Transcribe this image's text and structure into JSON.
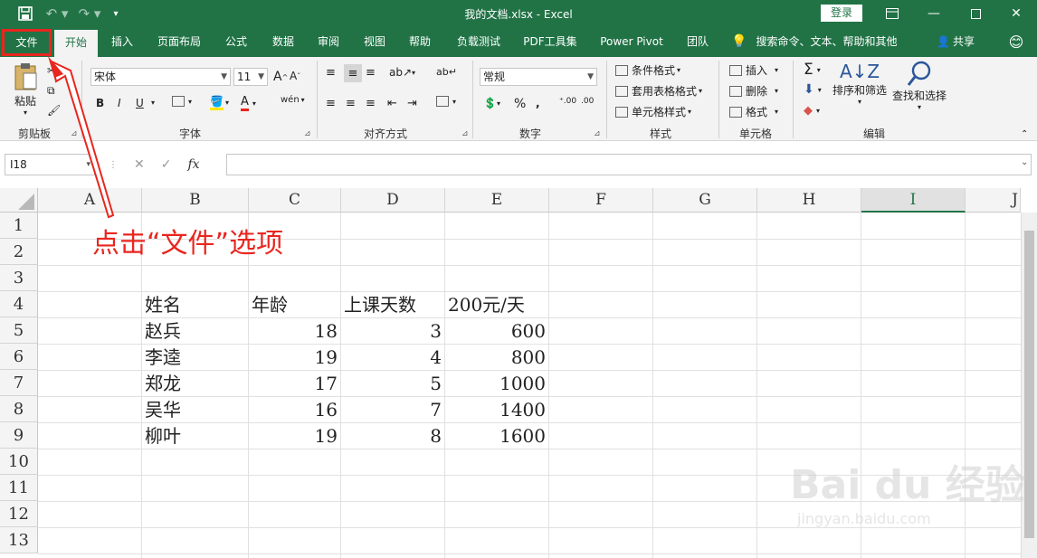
{
  "window": {
    "title": "我的文档.xlsx  -  Excel",
    "login_label": "登录",
    "buttons": [
      "ribbon-display-icon",
      "minimize-icon",
      "maximize-icon",
      "close-icon"
    ]
  },
  "quick_access": [
    "save-icon",
    "undo-icon",
    "redo-icon",
    "customize-icon"
  ],
  "tabs": [
    {
      "label": "文件"
    },
    {
      "label": "开始"
    },
    {
      "label": "插入"
    },
    {
      "label": "页面布局"
    },
    {
      "label": "公式"
    },
    {
      "label": "数据"
    },
    {
      "label": "审阅"
    },
    {
      "label": "视图"
    },
    {
      "label": "帮助"
    },
    {
      "label": "负载测试"
    },
    {
      "label": "PDF工具集"
    },
    {
      "label": "Power Pivot"
    },
    {
      "label": "团队"
    },
    {
      "label": "搜索命令、文本、帮助和其他"
    },
    {
      "label": "共享"
    }
  ],
  "ribbon": {
    "clipboard": {
      "paste": "粘贴",
      "group": "剪贴板"
    },
    "font": {
      "family": "宋体",
      "size": "11",
      "bold": "B",
      "italic": "I",
      "underline": "U",
      "font_color": "A",
      "group": "字体"
    },
    "alignment": {
      "group": "对齐方式"
    },
    "number": {
      "format": "常规",
      "percent": "%",
      "group": "数字"
    },
    "styles": {
      "conditional": "条件格式",
      "table": "套用表格格式",
      "cell": "单元格样式",
      "group": "样式"
    },
    "cells": {
      "insert": "插入",
      "delete": "删除",
      "format": "格式",
      "group": "单元格"
    },
    "editing": {
      "sort": "排序和筛选",
      "find": "查找和选择",
      "group": "编辑"
    }
  },
  "formula_bar": {
    "name_box": "I18",
    "fx": "fx",
    "value": ""
  },
  "sheet": {
    "columns": [
      "A",
      "B",
      "C",
      "D",
      "E",
      "F",
      "G",
      "H",
      "I",
      "J"
    ],
    "selected_column": "I",
    "rows": [
      "1",
      "2",
      "3",
      "4",
      "5",
      "6",
      "7",
      "8",
      "9",
      "10",
      "11",
      "12",
      "13"
    ],
    "table": {
      "headers": [
        "姓名",
        "年龄",
        "上课天数",
        "200元/天"
      ],
      "records": [
        [
          "赵兵",
          "18",
          "3",
          "600"
        ],
        [
          "李逵",
          "19",
          "4",
          "800"
        ],
        [
          "郑龙",
          "17",
          "5",
          "1000"
        ],
        [
          "吴华",
          "16",
          "7",
          "1400"
        ],
        [
          "柳叶",
          "19",
          "8",
          "1600"
        ]
      ]
    }
  },
  "annotation": {
    "text": "点击“文件”选项",
    "color": "#e8261f"
  },
  "watermark": {
    "main": "Bai du 经验",
    "sub": "jingyan.baidu.com"
  },
  "colors": {
    "brand": "#217346",
    "annotation": "#e8261f"
  }
}
